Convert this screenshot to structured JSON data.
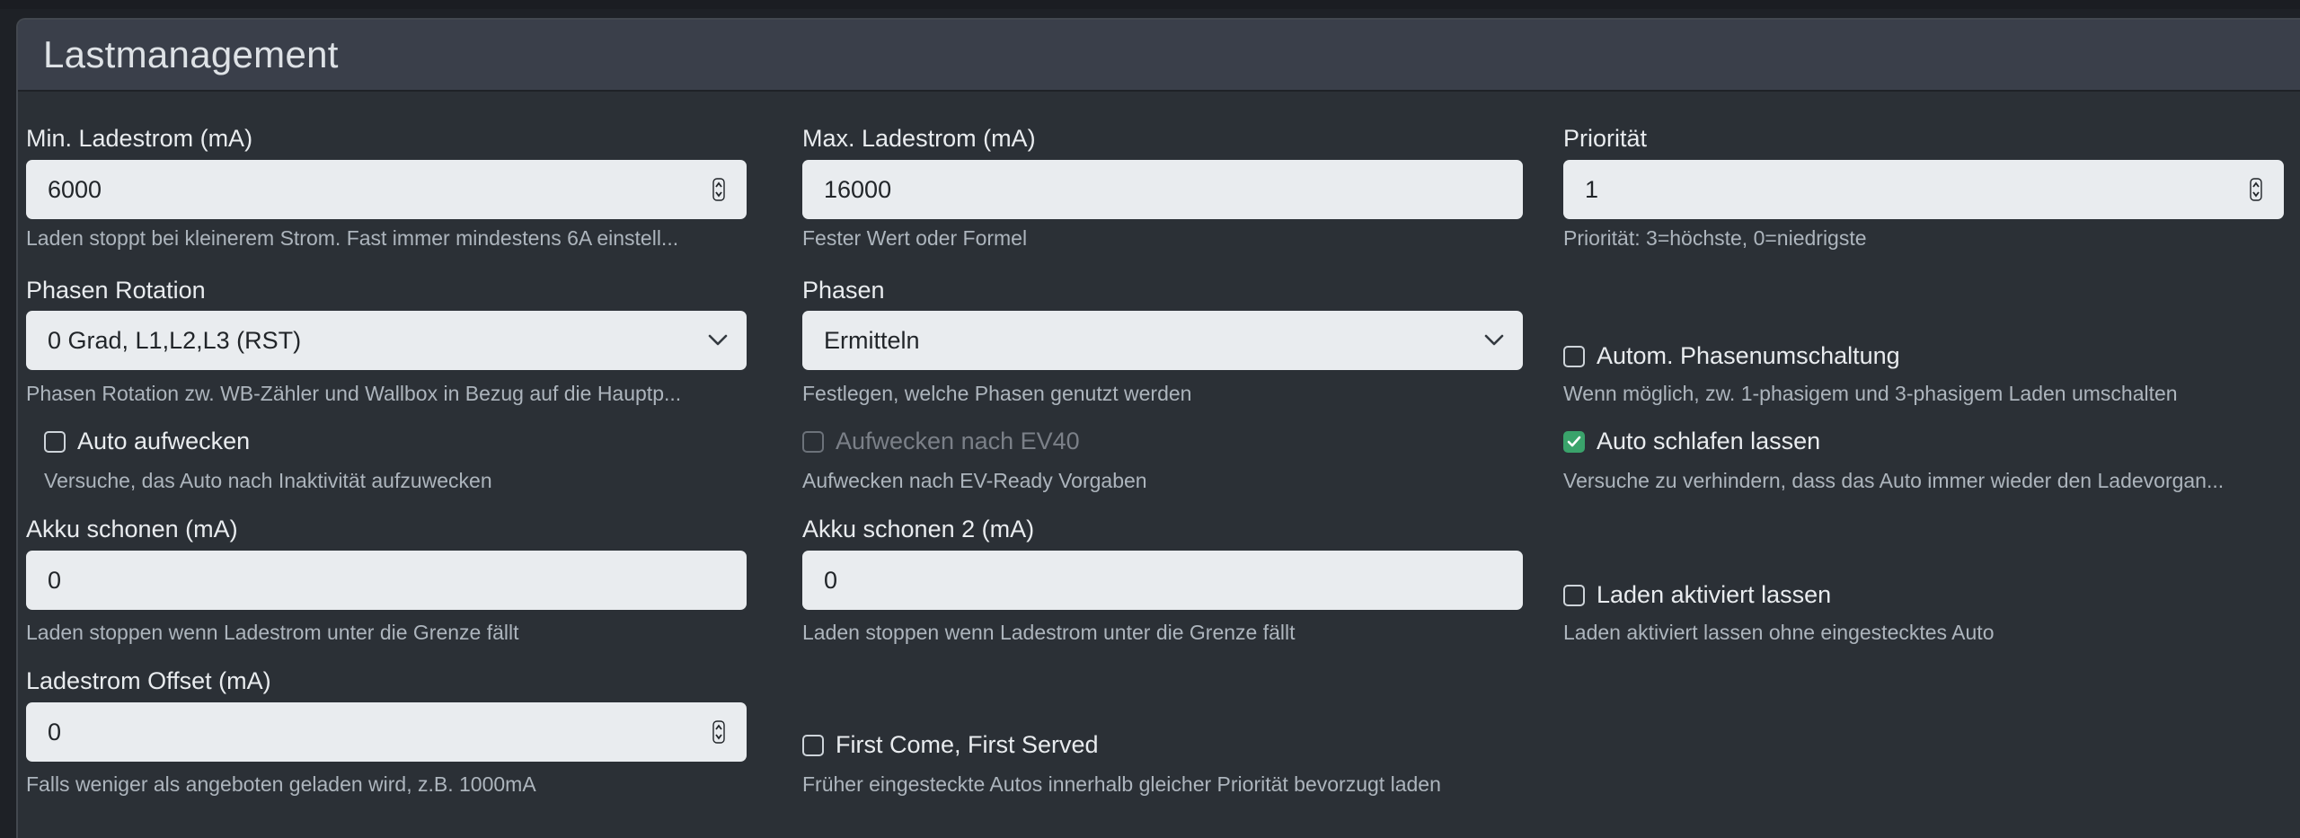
{
  "panel": {
    "title": "Lastmanagement"
  },
  "fields": {
    "min_current": {
      "label": "Min. Ladestrom (mA)",
      "value": "6000",
      "help": "Laden stoppt bei kleinerem Strom. Fast immer mindestens 6A einstell..."
    },
    "max_current": {
      "label": "Max. Ladestrom (mA)",
      "value": "16000",
      "help": "Fester Wert oder Formel"
    },
    "priority": {
      "label": "Priorität",
      "value": "1",
      "help": "Priorität: 3=höchste, 0=niedrigste"
    },
    "phase_rotation": {
      "label": "Phasen Rotation",
      "value": "0 Grad, L1,L2,L3 (RST)",
      "help": "Phasen Rotation zw. WB-Zähler und Wallbox in Bezug auf die Hauptp..."
    },
    "phases": {
      "label": "Phasen",
      "value": "Ermitteln",
      "help": "Festlegen, welche Phasen genutzt werden"
    },
    "battery_save": {
      "label": "Akku schonen (mA)",
      "value": "0",
      "help": "Laden stoppen wenn Ladestrom unter die Grenze fällt"
    },
    "battery_save_2": {
      "label": "Akku schonen 2 (mA)",
      "value": "0",
      "help": "Laden stoppen wenn Ladestrom unter die Grenze fällt"
    },
    "current_offset": {
      "label": "Ladestrom Offset (mA)",
      "value": "0",
      "help": "Falls weniger als angeboten geladen wird, z.B. 1000mA"
    }
  },
  "checks": {
    "auto_phase_switch": {
      "label": "Autom. Phasenumschaltung",
      "checked": false,
      "disabled": false,
      "help": "Wenn möglich, zw. 1-phasigem und 3-phasigem Laden umschalten"
    },
    "auto_wakeup": {
      "label": "Auto aufwecken",
      "checked": false,
      "disabled": false,
      "help": "Versuche, das Auto nach Inaktivität aufzuwecken"
    },
    "wakeup_ev40": {
      "label": "Aufwecken nach EV40",
      "checked": false,
      "disabled": true,
      "help": "Aufwecken nach EV-Ready Vorgaben"
    },
    "auto_sleep": {
      "label": "Auto schlafen lassen",
      "checked": true,
      "disabled": false,
      "help": "Versuche zu verhindern, dass das Auto immer wieder den Ladevorgan..."
    },
    "keep_enabled": {
      "label": "Laden aktiviert lassen",
      "checked": false,
      "disabled": false,
      "help": "Laden aktiviert lassen ohne eingestecktes Auto"
    },
    "first_come": {
      "label": "First Come, First Served",
      "checked": false,
      "disabled": false,
      "help": "Früher eingesteckte Autos innerhalb gleicher Priorität bevorzugt laden"
    }
  },
  "colors": {
    "accent_checked": "#3aa36b",
    "panel_bg": "#2b3036",
    "header_bg": "#3a3f4a"
  }
}
